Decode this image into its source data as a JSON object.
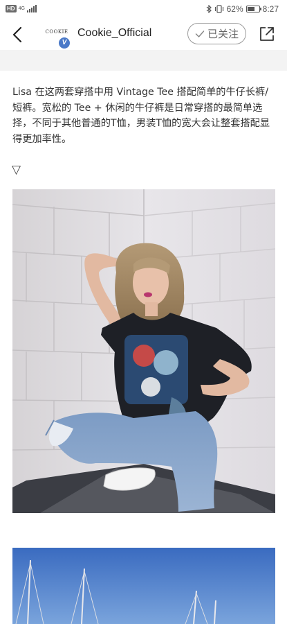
{
  "status_bar": {
    "hd": "HD",
    "network": "4G",
    "battery_percent": "62%",
    "battery_level": 0.62,
    "time": "8:27"
  },
  "header": {
    "logo_text": "COOKIE",
    "verified_mark": "V",
    "account_name": "Cookie_Official",
    "follow_label": "已关注",
    "icons": [
      "back-arrow-icon",
      "checkmark-icon",
      "share-icon"
    ]
  },
  "article": {
    "text": "Lisa 在这两套穿搭中用 Vintage Tee 搭配简单的牛仔长裤/短裤。宽松的 Tee + 休闲的牛仔裤是日常穿搭的最简单选择，不同于其他普通的T恤，男装T恤的宽大会让整套搭配显得更加率性。",
    "expand_glyph": "▽"
  },
  "colors": {
    "verified_badge": "#4a79c8",
    "band": "#f3f3f3"
  }
}
